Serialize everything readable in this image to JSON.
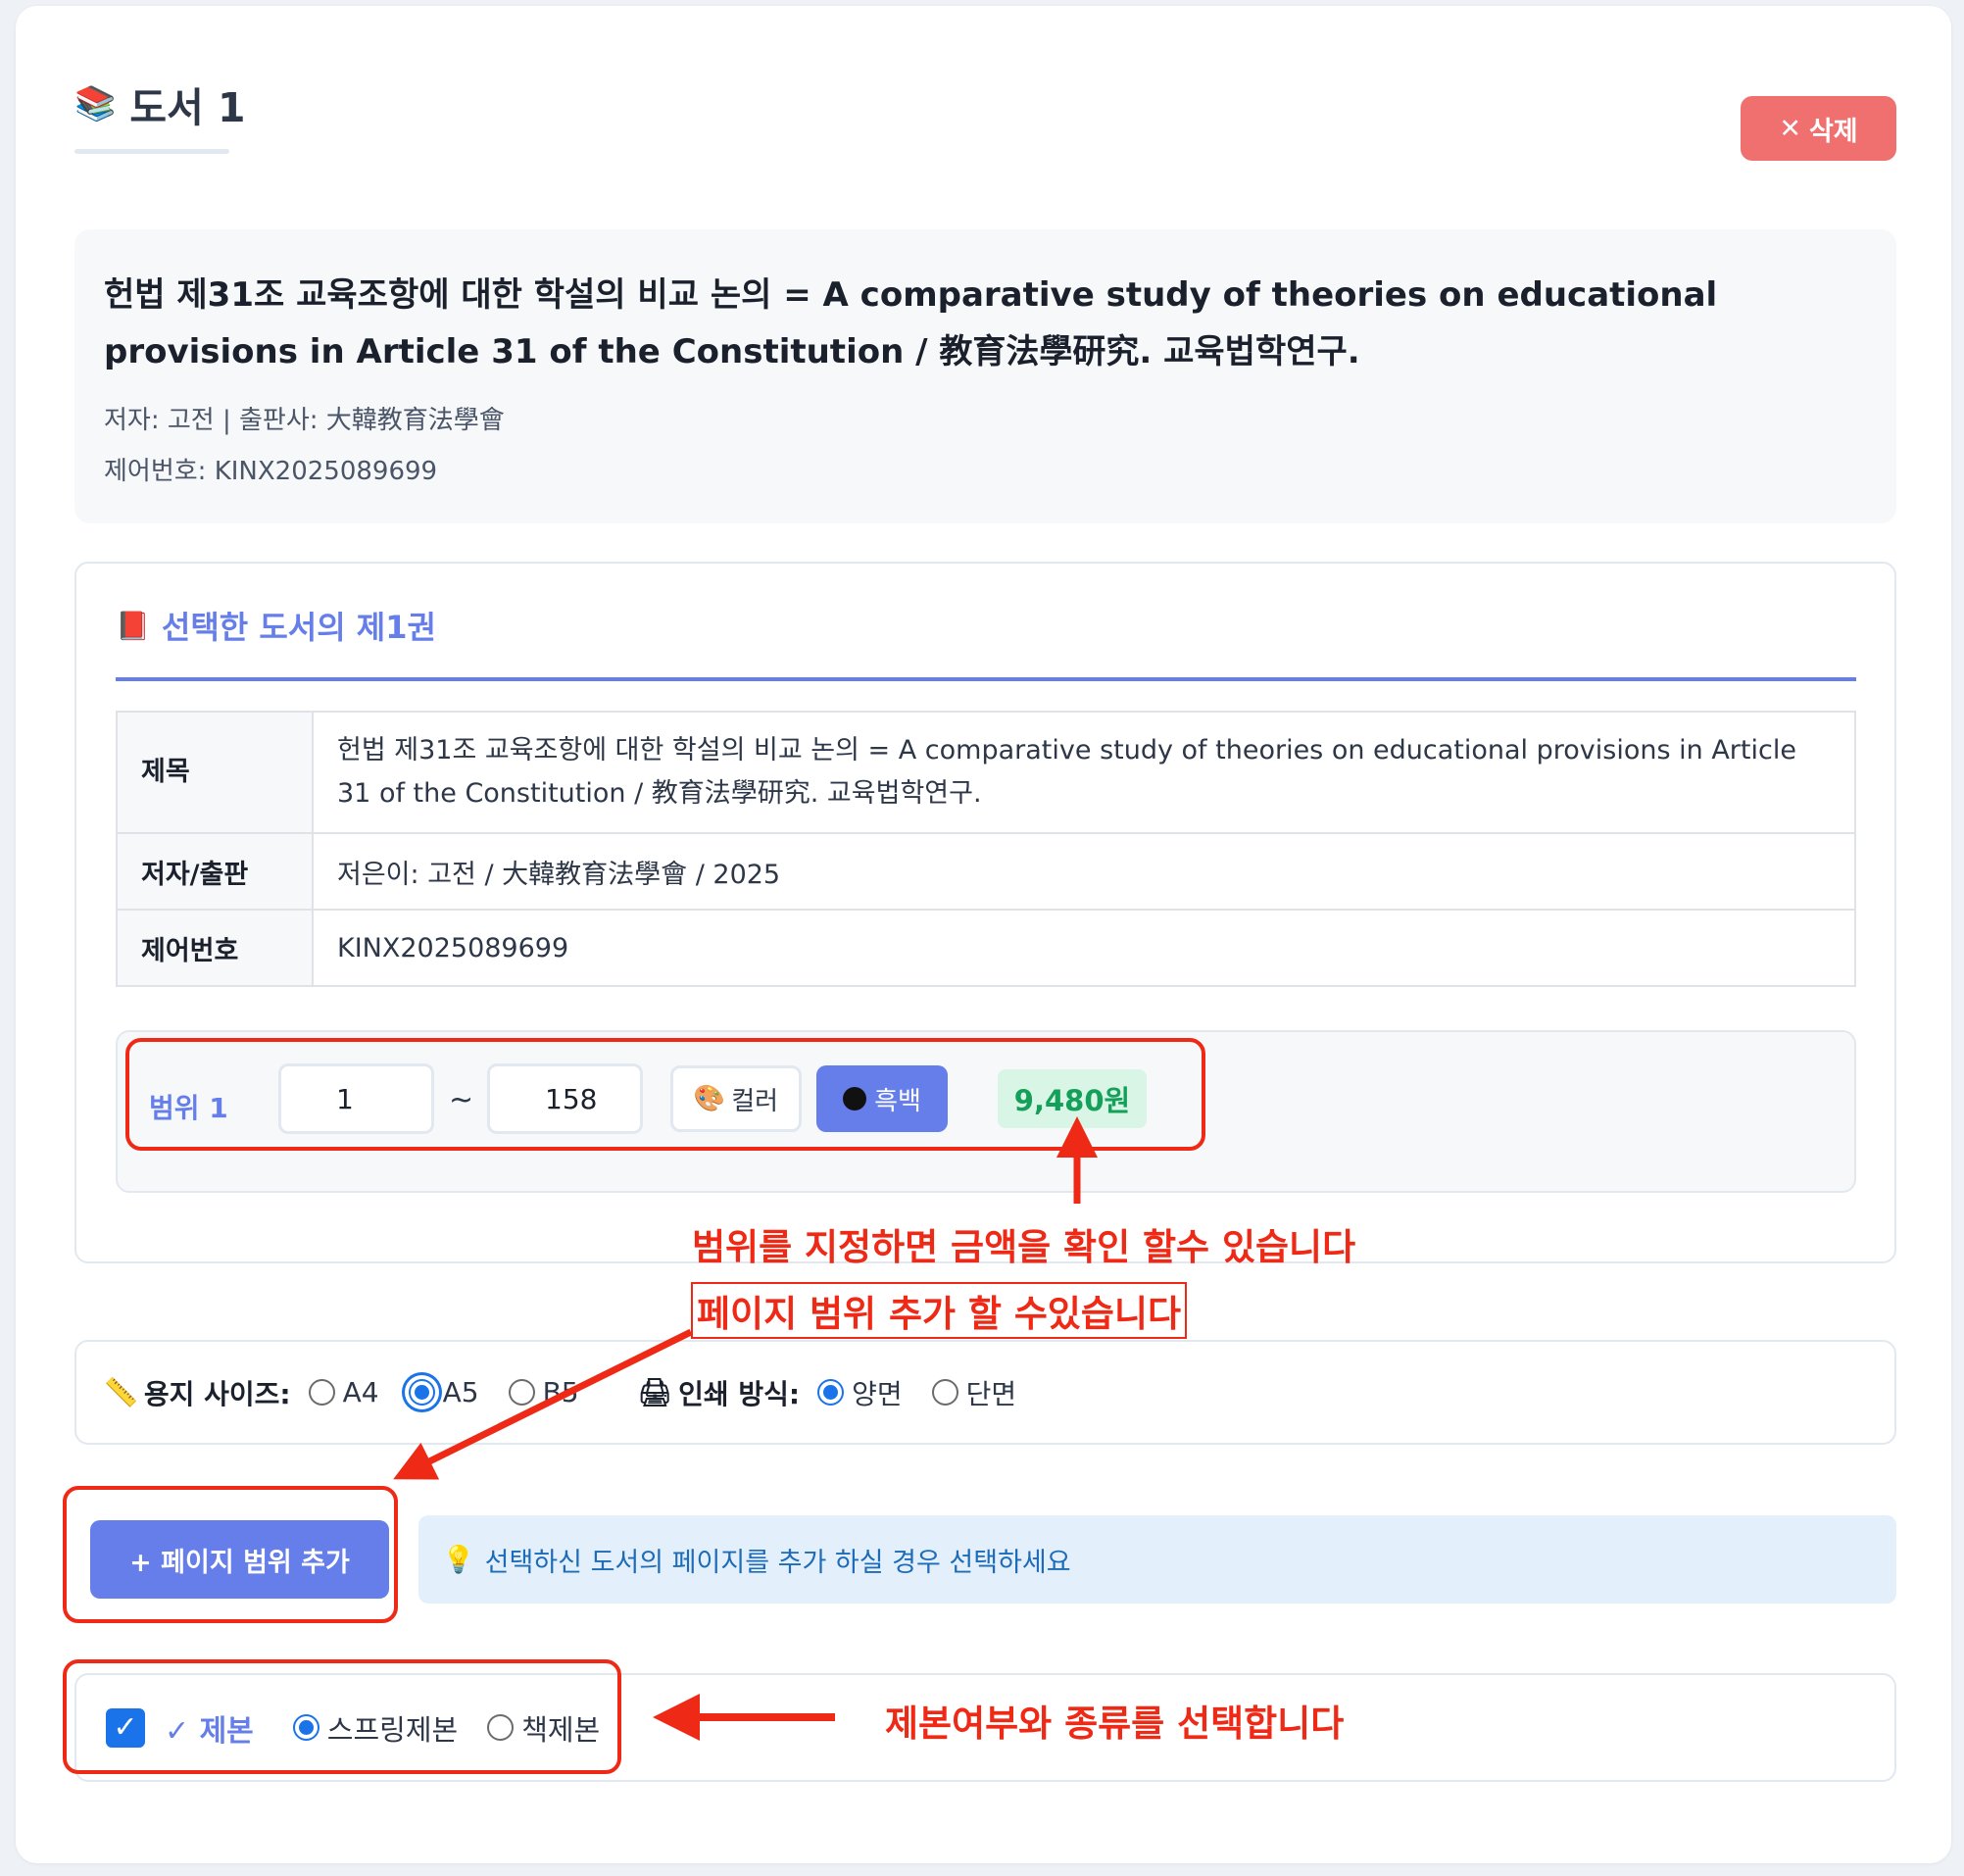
{
  "card": {
    "icon": "books-icon",
    "title": "도서 1",
    "delete_label": "삭제"
  },
  "info": {
    "title": "헌법 제31조 교육조항에 대한 학설의 비교 논의 = A comparative study of theories on educational provisions in Article 31 of the Constitution / 教育法學研究. 교육법학연구.",
    "author_publisher": "저자: 고전 | 출판사: 大韓教育法學會",
    "control_no": "제어번호: KINX2025089699"
  },
  "volume": {
    "icon": "red-book-icon",
    "heading": "선택한 도서의 제1권",
    "table": [
      {
        "label": "제목",
        "value": "헌법 제31조 교육조항에 대한 학설의 비교 논의 = A comparative study of theories on educational provisions in Article 31 of the Constitution / 教育法學研究. 교육법학연구."
      },
      {
        "label": "저자/출판",
        "value": "저은이: 고전 / 大韓教育法學會 / 2025"
      },
      {
        "label": "제어번호",
        "value": "KINX2025089699"
      }
    ],
    "range": {
      "label": "범위 1",
      "start": "1",
      "tilde": "~",
      "end": "158",
      "color_label": "컬러",
      "bw_label": "흑백",
      "price": "9,480원"
    }
  },
  "options": {
    "paper_label": "용지 사이즈:",
    "paper_options": [
      "A4",
      "A5",
      "B5"
    ],
    "paper_selected": "A5",
    "print_label": "인쇄 방식:",
    "print_options": [
      "양면",
      "단면"
    ],
    "print_selected": "양면"
  },
  "add_range": {
    "button_label": "+ 페이지 범위 추가",
    "hint": "선택하신 도서의 페이지를 추가 하실 경우 선택하세요"
  },
  "binding": {
    "checked": true,
    "title": "✓ 제본",
    "options": [
      "스프링제본",
      "책제본"
    ],
    "selected": "스프링제본"
  },
  "annotations": {
    "price_note": "범위를 지정하면 금액을 확인 할수 있습니다",
    "add_note": "페이지 범위 추가 할 수있습니다",
    "binding_note": "제본여부와 종류를 선택합니다",
    "color": "#ee2a17"
  },
  "colors": {
    "accent": "#667eea",
    "danger": "#f06f6f",
    "price_green": "#15a05a",
    "radio_blue": "#1a73e8"
  }
}
